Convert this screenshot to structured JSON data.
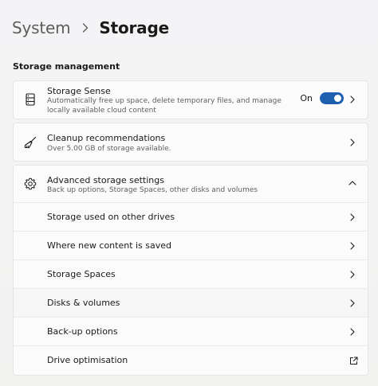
{
  "breadcrumb": {
    "parent": "System",
    "current": "Storage"
  },
  "section": {
    "title": "Storage management"
  },
  "storage_sense": {
    "title": "Storage Sense",
    "description": "Automatically free up space, delete temporary files, and manage locally available cloud content",
    "toggle_label": "On",
    "toggle_on": true,
    "icon": "storage-drive-icon"
  },
  "cleanup": {
    "title": "Cleanup recommendations",
    "description": "Over 5.00 GB of storage available.",
    "icon": "broom-icon"
  },
  "advanced": {
    "title": "Advanced storage settings",
    "description": "Back up options, Storage Spaces, other disks and volumes",
    "icon": "gear-icon",
    "expanded": true,
    "items": [
      {
        "label": "Storage used on other drives",
        "icon": "chevron-right-icon"
      },
      {
        "label": "Where new content is saved",
        "icon": "chevron-right-icon"
      },
      {
        "label": "Storage Spaces",
        "icon": "chevron-right-icon"
      },
      {
        "label": "Disks & volumes",
        "icon": "chevron-right-icon"
      },
      {
        "label": "Back-up options",
        "icon": "chevron-right-icon"
      },
      {
        "label": "Drive optimisation",
        "icon": "external-link-icon"
      }
    ]
  },
  "colors": {
    "accent": "#1f5fb0",
    "background": "#f3f3f3",
    "card": "#fbfbfb"
  }
}
